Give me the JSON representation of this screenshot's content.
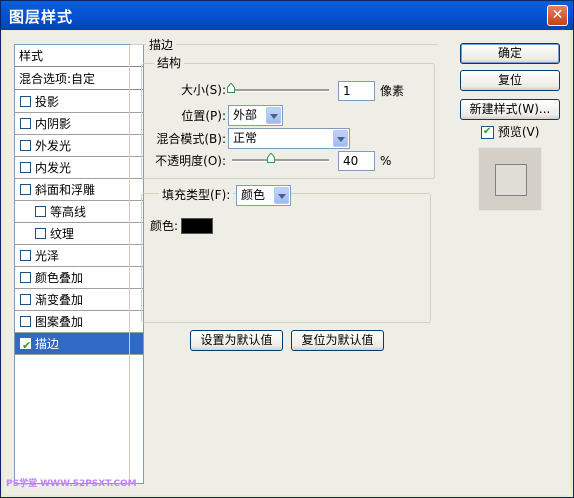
{
  "window": {
    "title": "图层样式",
    "close_glyph": "✕"
  },
  "style_list": {
    "header": "样式",
    "blend": "混合选项:自定",
    "items": [
      {
        "label": "投影",
        "checked": false,
        "indent": 0
      },
      {
        "label": "内阴影",
        "checked": false,
        "indent": 0
      },
      {
        "label": "外发光",
        "checked": false,
        "indent": 0
      },
      {
        "label": "内发光",
        "checked": false,
        "indent": 0
      },
      {
        "label": "斜面和浮雕",
        "checked": false,
        "indent": 0
      },
      {
        "label": "等高线",
        "checked": false,
        "indent": 1
      },
      {
        "label": "纹理",
        "checked": false,
        "indent": 1
      },
      {
        "label": "光泽",
        "checked": false,
        "indent": 0
      },
      {
        "label": "颜色叠加",
        "checked": false,
        "indent": 0
      },
      {
        "label": "渐变叠加",
        "checked": false,
        "indent": 0
      },
      {
        "label": "图案叠加",
        "checked": false,
        "indent": 0
      },
      {
        "label": "描边",
        "checked": true,
        "indent": 0,
        "selected": true
      }
    ]
  },
  "stroke": {
    "group_title": "描边",
    "structure_title": "结构",
    "size_label": "大小(S):",
    "size_value": "1",
    "size_unit": "像素",
    "position_label": "位置(P):",
    "position_value": "外部",
    "blend_label": "混合模式(B):",
    "blend_value": "正常",
    "opacity_label": "不透明度(O):",
    "opacity_value": "40",
    "opacity_unit": "%",
    "fill_type_label": "填充类型(F):",
    "fill_type_value": "颜色",
    "color_label": "颜色:",
    "color_value": "#000000"
  },
  "buttons": {
    "ok": "确定",
    "reset": "复位",
    "new_style": "新建样式(W)...",
    "preview": "预览(V)",
    "set_default": "设置为默认值",
    "reset_default": "复位为默认值"
  },
  "watermark": "PS学堂 WWW.52PSXT.COM"
}
